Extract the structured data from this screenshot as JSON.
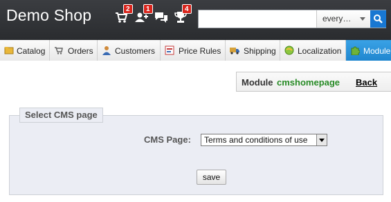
{
  "header": {
    "shop_title": "Demo Shop",
    "icons": [
      {
        "name": "cart-icon",
        "badge": "2"
      },
      {
        "name": "customer-icon",
        "badge": "1"
      },
      {
        "name": "messages-icon",
        "badge": ""
      },
      {
        "name": "trophy-icon",
        "badge": "4"
      }
    ],
    "search": {
      "value": "",
      "placeholder": "",
      "scope": "every…"
    }
  },
  "tabs": [
    {
      "label": "Catalog",
      "icon": "catalog-icon"
    },
    {
      "label": "Orders",
      "icon": "cart-icon"
    },
    {
      "label": "Customers",
      "icon": "person-icon"
    },
    {
      "label": "Price Rules",
      "icon": "price-rules-icon"
    },
    {
      "label": "Shipping",
      "icon": "truck-icon"
    },
    {
      "label": "Localization",
      "icon": "globe-icon"
    },
    {
      "label": "Module",
      "icon": "puzzle-icon",
      "active": true
    }
  ],
  "toolbar": {
    "module_label": "Module",
    "module_name": "cmshomepage",
    "back_label": "Back"
  },
  "form": {
    "legend": "Select CMS page",
    "cms_page_label": "CMS Page:",
    "cms_page_value": "Terms and conditions of use",
    "save_label": "save"
  },
  "colors": {
    "header_bg": "#2f3134",
    "active_tab": "#2a93dc",
    "badge": "#d9251d",
    "module_name": "#268a24",
    "panel_bg": "#ebedf4"
  }
}
